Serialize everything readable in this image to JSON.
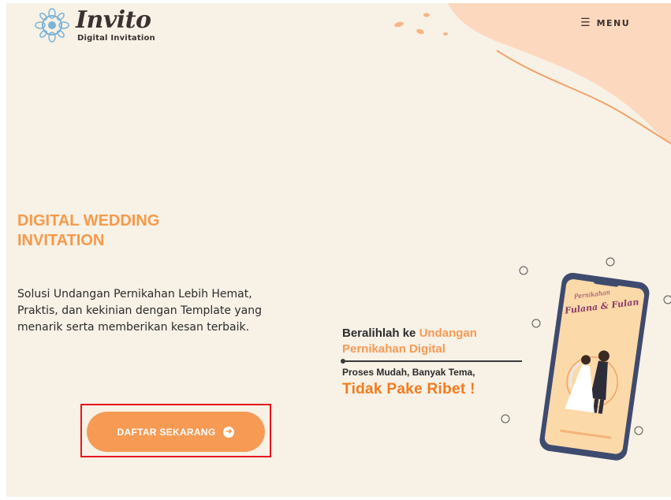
{
  "header": {
    "logo_word": "Invito",
    "logo_sub": "Digital Invitation",
    "menu_label": "MENU",
    "menu_icon": "hamburger-icon"
  },
  "hero": {
    "title": "DIGITAL WEDDING INVITATION",
    "description": "Solusi Undangan Pernikahan Lebih Hemat, Praktis, dan kekinian dengan Template yang menarik serta memberikan kesan terbaik.",
    "cta_label": "DAFTAR SEKARANG",
    "cta_icon": "arrow-circle-right-icon"
  },
  "promo": {
    "line1_prefix": "Beralihlah ke",
    "line1_highlight": "Undangan",
    "line2": "Pernikahan Digital",
    "sub": "Proses Mudah, Banyak Tema,",
    "big": "Tidak Pake Ribet !"
  },
  "phone_card": {
    "script1": "Pernikahan",
    "names": "Fulana & Fulan"
  },
  "colors": {
    "accent": "#f79a54",
    "title_orange": "#f59a4a",
    "background": "#f7f1e6",
    "blob": "#fcd9be",
    "dark_text": "#2c2c2c",
    "highlight_box": "#e8141c"
  }
}
